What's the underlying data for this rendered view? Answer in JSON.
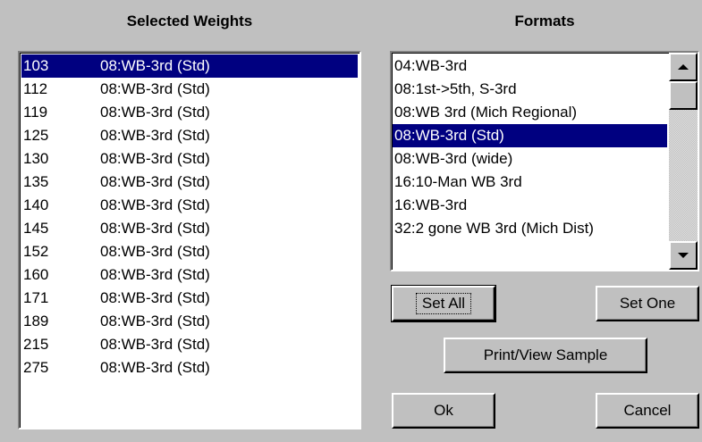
{
  "weights_heading": "Selected Weights",
  "formats_heading": "Formats",
  "weights": [
    {
      "weight": "103",
      "format": "08:WB-3rd (Std)",
      "selected": true
    },
    {
      "weight": "112",
      "format": "08:WB-3rd (Std)"
    },
    {
      "weight": "119",
      "format": "08:WB-3rd (Std)"
    },
    {
      "weight": "125",
      "format": "08:WB-3rd (Std)"
    },
    {
      "weight": "130",
      "format": "08:WB-3rd (Std)"
    },
    {
      "weight": "135",
      "format": "08:WB-3rd (Std)"
    },
    {
      "weight": "140",
      "format": "08:WB-3rd (Std)"
    },
    {
      "weight": "145",
      "format": "08:WB-3rd (Std)"
    },
    {
      "weight": "152",
      "format": "08:WB-3rd (Std)"
    },
    {
      "weight": "160",
      "format": "08:WB-3rd (Std)"
    },
    {
      "weight": "171",
      "format": "08:WB-3rd (Std)"
    },
    {
      "weight": "189",
      "format": "08:WB-3rd (Std)"
    },
    {
      "weight": "215",
      "format": "08:WB-3rd (Std)"
    },
    {
      "weight": "275",
      "format": "08:WB-3rd (Std)"
    }
  ],
  "formats": [
    {
      "label": "04:WB-3rd"
    },
    {
      "label": "08:1st->5th, S-3rd"
    },
    {
      "label": "08:WB 3rd (Mich Regional)"
    },
    {
      "label": "08:WB-3rd (Std)",
      "selected": true
    },
    {
      "label": "08:WB-3rd (wide)"
    },
    {
      "label": "16:10-Man WB 3rd"
    },
    {
      "label": "16:WB-3rd"
    },
    {
      "label": "32:2 gone WB 3rd (Mich Dist)"
    }
  ],
  "buttons": {
    "set_all": "Set All",
    "set_one": "Set One",
    "print_view": "Print/View Sample",
    "ok": "Ok",
    "cancel": "Cancel"
  },
  "colors": {
    "selection": "#000080",
    "face": "#c0c0c0"
  }
}
